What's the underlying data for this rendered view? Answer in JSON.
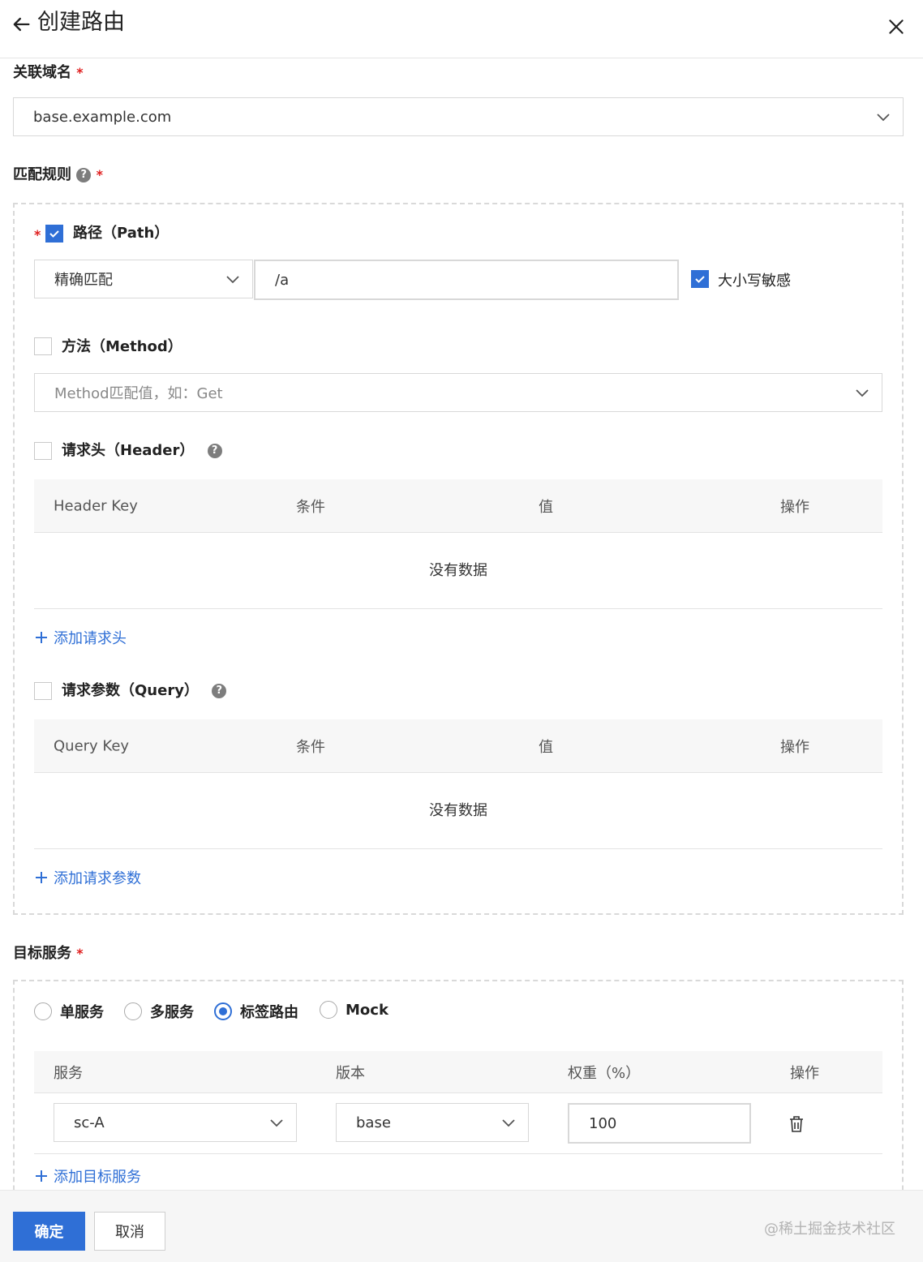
{
  "header": {
    "title": "创建路由"
  },
  "domain": {
    "label": "关联域名",
    "value": "base.example.com"
  },
  "match_rules": {
    "label": "匹配规则",
    "path": {
      "label": "路径（Path）",
      "checked": true,
      "match_type": "精确匹配",
      "value": "/a",
      "case_sensitive_label": "大小写敏感",
      "case_sensitive": true
    },
    "method": {
      "label": "方法（Method）",
      "checked": false,
      "placeholder": "Method匹配值，如：Get"
    },
    "header": {
      "label": "请求头（Header）",
      "checked": false,
      "columns": [
        "Header Key",
        "条件",
        "值",
        "操作"
      ],
      "empty_text": "没有数据",
      "add_label": "添加请求头"
    },
    "query": {
      "label": "请求参数（Query）",
      "checked": false,
      "columns": [
        "Query Key",
        "条件",
        "值",
        "操作"
      ],
      "empty_text": "没有数据",
      "add_label": "添加请求参数"
    }
  },
  "target_service": {
    "label": "目标服务",
    "options": [
      "单服务",
      "多服务",
      "标签路由",
      "Mock"
    ],
    "selected": "标签路由",
    "columns": [
      "服务",
      "版本",
      "权重（%）",
      "操作"
    ],
    "rows": [
      {
        "service": "sc-A",
        "version": "base",
        "weight": "100"
      }
    ],
    "add_label": "添加目标服务"
  },
  "footer": {
    "confirm_label": "确定",
    "cancel_label": "取消",
    "watermark": "@稀土掘金技术社区"
  },
  "colors": {
    "primary": "#2f6fd6",
    "required": "#e02020"
  }
}
